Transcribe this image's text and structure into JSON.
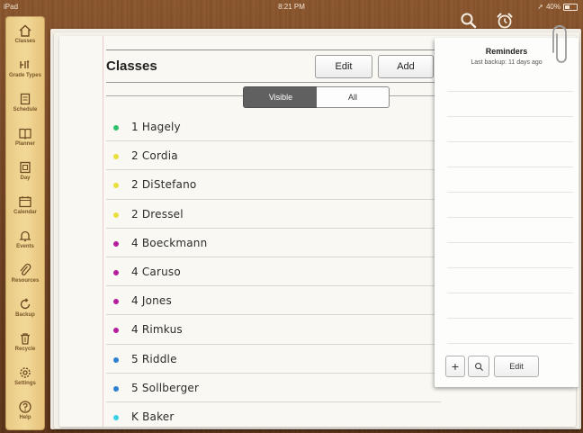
{
  "status_bar": {
    "device": "iPad",
    "time": "8:21 PM",
    "battery": "40%"
  },
  "top_icons": [
    "search-icon",
    "alarm-clock-icon"
  ],
  "sidebar": {
    "items": [
      {
        "label": "Classes",
        "icon": "house-icon"
      },
      {
        "label": "Grade Types",
        "icon": "grade-types-icon"
      },
      {
        "label": "Schedule",
        "icon": "schedule-icon"
      },
      {
        "label": "Planner",
        "icon": "book-icon"
      },
      {
        "label": "Day",
        "icon": "day-icon"
      },
      {
        "label": "Calendar",
        "icon": "calendar-icon"
      },
      {
        "label": "Events",
        "icon": "bell-icon"
      },
      {
        "label": "Resources",
        "icon": "paperclip-icon"
      },
      {
        "label": "Backup",
        "icon": "backup-icon"
      },
      {
        "label": "Recycle",
        "icon": "trash-icon"
      },
      {
        "label": "Settings",
        "icon": "gear-icon"
      },
      {
        "label": "Help",
        "icon": "help-icon"
      }
    ]
  },
  "classes": {
    "title": "Classes",
    "edit_label": "Edit",
    "add_label": "Add",
    "filter": {
      "options": [
        "Visible",
        "All"
      ],
      "selected": "Visible"
    },
    "items": [
      {
        "name": "1 Hagely",
        "color": "#2fc36b"
      },
      {
        "name": "2 Cordia",
        "color": "#e9df3e"
      },
      {
        "name": "2 DiStefano",
        "color": "#e9df3e"
      },
      {
        "name": "2 Dressel",
        "color": "#e9df3e"
      },
      {
        "name": "4 Boeckmann",
        "color": "#b5209d"
      },
      {
        "name": "4 Caruso",
        "color": "#b5209d"
      },
      {
        "name": "4 Jones",
        "color": "#b5209d"
      },
      {
        "name": "4 Rimkus",
        "color": "#b5209d"
      },
      {
        "name": "5 Riddle",
        "color": "#2f7fd1"
      },
      {
        "name": "5 Sollberger",
        "color": "#2f7fd1"
      },
      {
        "name": "K Baker",
        "color": "#3bd0e6"
      }
    ]
  },
  "reminders": {
    "title": "Reminders",
    "last_backup": "Last backup: 11 days ago",
    "add_symbol": "+",
    "edit_label": "Edit"
  }
}
